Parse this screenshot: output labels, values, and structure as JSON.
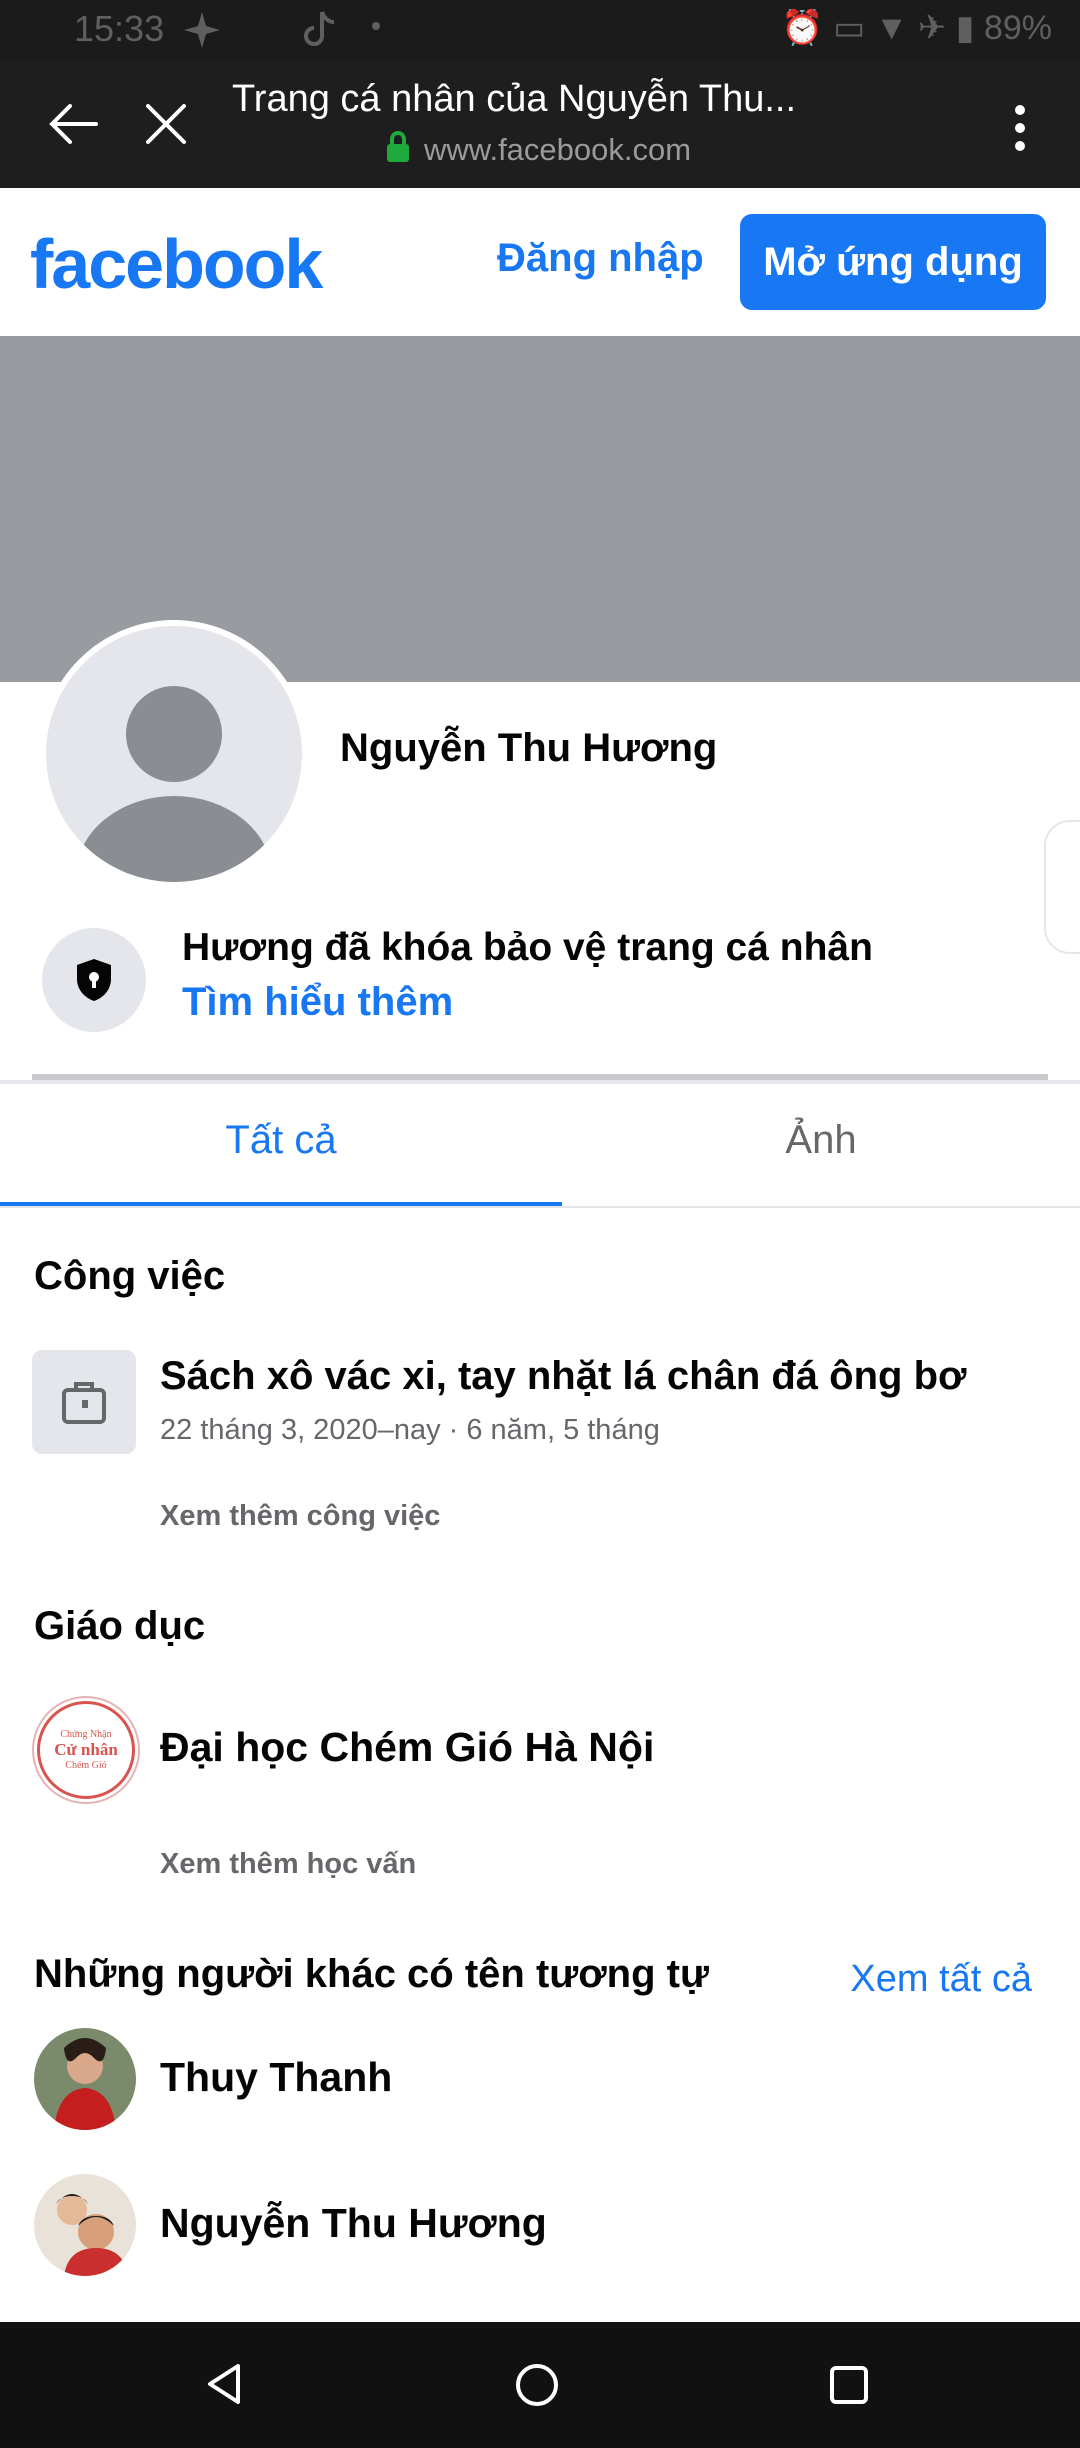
{
  "status_bar": {
    "time": "15:33",
    "battery": "89%"
  },
  "browser": {
    "title": "Trang cá nhân của Nguyễn Thu...",
    "url": "www.facebook.com"
  },
  "header": {
    "logo": "facebook",
    "login_label": "Đăng nhập",
    "open_app_label": "Mở ứng dụng",
    "brand_color": "#1877f2"
  },
  "profile": {
    "name": "Nguyễn Thu Hương",
    "lock_message": "Hương đã khóa bảo vệ trang cá nhân",
    "learn_more": "Tìm hiểu thêm"
  },
  "tabs": [
    {
      "label": "Tất cả",
      "active": true
    },
    {
      "label": "Ảnh",
      "active": false
    }
  ],
  "work": {
    "title": "Công việc",
    "item_title": "Sách xô vác xi, tay nhặt lá chân đá ông bơ",
    "item_sub": "22 tháng 3, 2020–nay · 6 năm, 5 tháng",
    "more": "Xem thêm công việc"
  },
  "education": {
    "title": "Giáo dục",
    "school": "Đại học Chém Gió Hà Nội",
    "more": "Xem thêm học vấn",
    "logo_text_top": "Chứng Nhận",
    "logo_text_main": "Cử nhân",
    "logo_text_bottom": "Chém Gió"
  },
  "similar": {
    "title": "Những người khác có tên tương tự",
    "see_all": "Xem tất cả",
    "people": [
      {
        "name": "Thuy Thanh"
      },
      {
        "name": "Nguyễn Thu Hương"
      }
    ]
  }
}
